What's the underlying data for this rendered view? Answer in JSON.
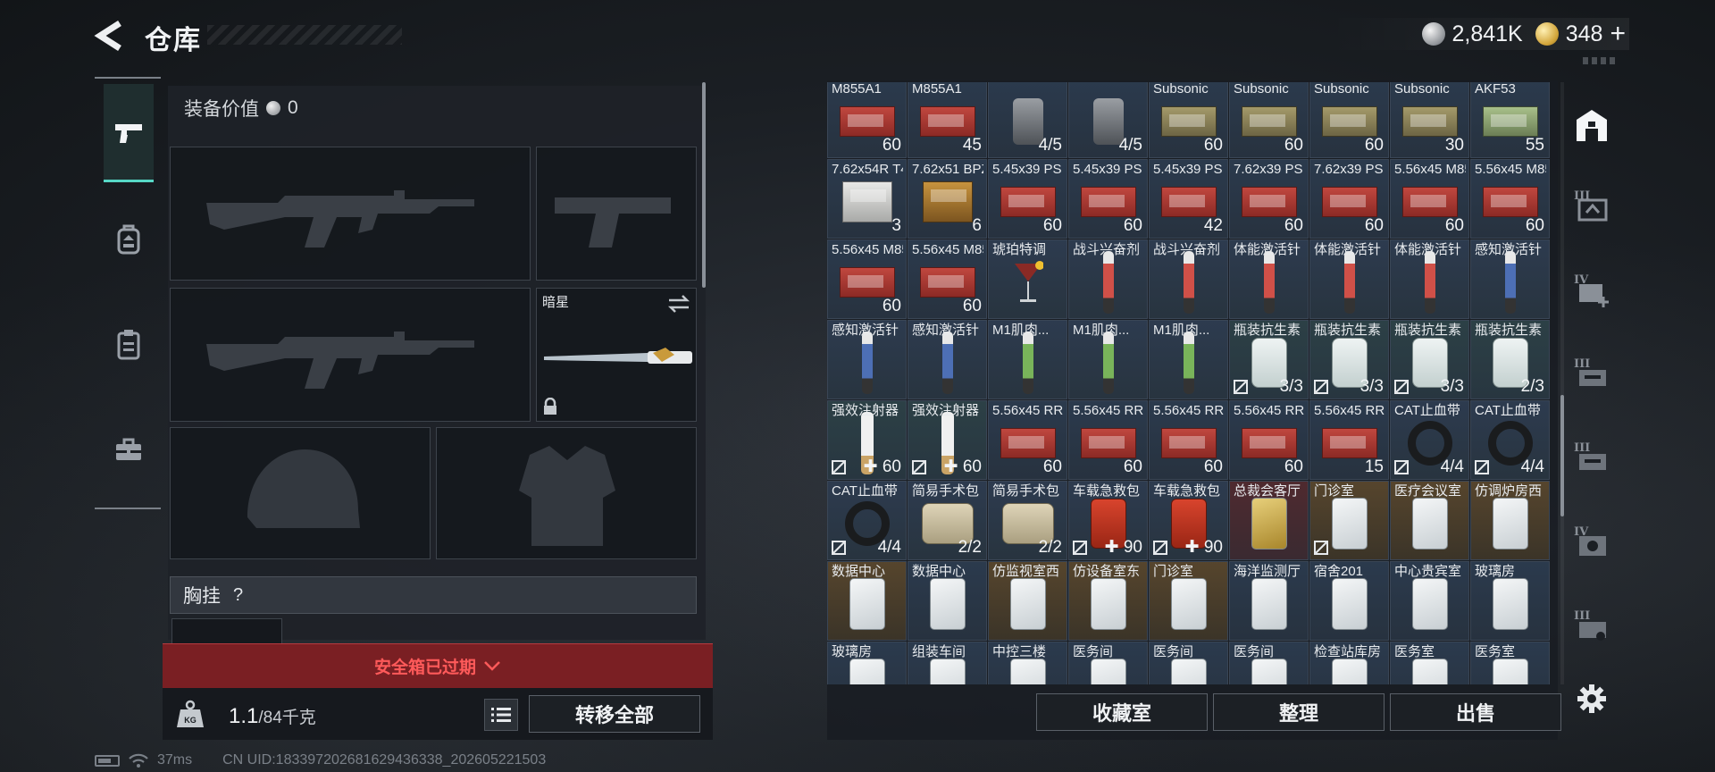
{
  "header": {
    "title": "仓库",
    "currencies": [
      {
        "icon": "silver-coin-icon",
        "value": "2,841K"
      },
      {
        "icon": "gold-coin-icon",
        "value": "348"
      }
    ],
    "add_label": "+"
  },
  "left_rail": {
    "items": [
      {
        "icon": "pistol-icon",
        "active": true
      },
      {
        "icon": "backpack-icon",
        "active": false
      },
      {
        "icon": "clipboard-icon",
        "active": false
      },
      {
        "icon": "toolbox-icon",
        "active": false
      }
    ]
  },
  "equipment": {
    "value_label": "装备价值",
    "value": "0",
    "melee_name": "暗星",
    "chest_rig_label": "胸挂",
    "chest_help": "?",
    "safebox_expired": "安全箱已过期",
    "weight_value": "1.1",
    "weight_capacity": "/84千克",
    "weight_icon_text": "KG",
    "transfer_all": "转移全部"
  },
  "status_bar": {
    "ping": "37ms",
    "uid": "CN UID:18339720268162943633​8_202605221503"
  },
  "inventory": {
    "items": [
      {
        "name": "M855A1",
        "qty": "60",
        "art": "box-red",
        "tone": "t-ammo"
      },
      {
        "name": "M855A1",
        "qty": "45",
        "art": "box-red",
        "tone": "t-ammo"
      },
      {
        "name": "",
        "qty": "4/5",
        "art": "grenade",
        "tone": "t-ammo"
      },
      {
        "name": "",
        "qty": "4/5",
        "art": "grenade",
        "tone": "t-ammo"
      },
      {
        "name": "Subsonic",
        "qty": "60",
        "art": "box-olive",
        "tone": "t-ammo"
      },
      {
        "name": "Subsonic",
        "qty": "60",
        "art": "box-olive",
        "tone": "t-ammo"
      },
      {
        "name": "Subsonic",
        "qty": "60",
        "art": "box-olive",
        "tone": "t-ammo"
      },
      {
        "name": "Subsonic",
        "qty": "30",
        "art": "box-olive",
        "tone": "t-ammo"
      },
      {
        "name": "AKF53",
        "qty": "55",
        "art": "box-green",
        "tone": "t-ammo"
      },
      {
        "name": "7.62x54R T46M",
        "qty": "3",
        "art": "box-white",
        "tone": "t-ammo"
      },
      {
        "name": "7.62x51 BPZ",
        "qty": "6",
        "art": "box-brown",
        "tone": "t-ammo"
      },
      {
        "name": "5.45x39 PS",
        "qty": "60",
        "art": "box-red",
        "tone": "t-ammo"
      },
      {
        "name": "5.45x39 PS",
        "qty": "60",
        "art": "box-red",
        "tone": "t-ammo"
      },
      {
        "name": "5.45x39 PS",
        "qty": "42",
        "art": "box-red",
        "tone": "t-ammo"
      },
      {
        "name": "7.62x39 PS",
        "qty": "60",
        "art": "box-red",
        "tone": "t-ammo"
      },
      {
        "name": "7.62x39 PS",
        "qty": "60",
        "art": "box-red",
        "tone": "t-ammo"
      },
      {
        "name": "5.56x45 M855",
        "qty": "60",
        "art": "box-red",
        "tone": "t-ammo"
      },
      {
        "name": "5.56x45 M855",
        "qty": "60",
        "art": "box-red",
        "tone": "t-ammo"
      },
      {
        "name": "5.56x45 M855",
        "qty": "60",
        "art": "box-red",
        "tone": "t-ammo"
      },
      {
        "name": "5.56x45 M855",
        "qty": "60",
        "art": "box-red",
        "tone": "t-ammo"
      },
      {
        "name": "琥珀特调",
        "qty": "",
        "art": "glass",
        "tone": "t-med"
      },
      {
        "name": "战斗兴奋剂",
        "qty": "",
        "art": "syringe red",
        "tone": "t-med"
      },
      {
        "name": "战斗兴奋剂",
        "qty": "",
        "art": "syringe red",
        "tone": "t-med"
      },
      {
        "name": "体能激活针",
        "qty": "",
        "art": "syringe red",
        "tone": "t-med"
      },
      {
        "name": "体能激活针",
        "qty": "",
        "art": "syringe red",
        "tone": "t-med"
      },
      {
        "name": "体能激活针",
        "qty": "",
        "art": "syringe red",
        "tone": "t-med"
      },
      {
        "name": "感知激活针",
        "qty": "",
        "art": "syringe blue",
        "tone": "t-med"
      },
      {
        "name": "感知激活针",
        "qty": "",
        "art": "syringe blue",
        "tone": "t-med"
      },
      {
        "name": "感知激活针",
        "qty": "",
        "art": "syringe blue",
        "tone": "t-med"
      },
      {
        "name": "M1肌肉...",
        "qty": "",
        "art": "syringe green",
        "tone": "t-med"
      },
      {
        "name": "M1肌肉...",
        "qty": "",
        "art": "syringe green",
        "tone": "t-med"
      },
      {
        "name": "M1肌肉...",
        "qty": "",
        "art": "syringe green",
        "tone": "t-med"
      },
      {
        "name": "瓶装抗生素",
        "qty": "3/3",
        "art": "pills",
        "tone": "t-green",
        "badge": "durability"
      },
      {
        "name": "瓶装抗生素",
        "qty": "3/3",
        "art": "pills",
        "tone": "t-green",
        "badge": "durability"
      },
      {
        "name": "瓶装抗生素",
        "qty": "3/3",
        "art": "pills",
        "tone": "t-green",
        "badge": "durability"
      },
      {
        "name": "瓶装抗生素",
        "qty": "2/3",
        "art": "pills",
        "tone": "t-green"
      },
      {
        "name": "强效注射器",
        "qty": "✚ 60",
        "art": "syringe white",
        "tone": "t-green",
        "badge": "durability"
      },
      {
        "name": "强效注射器",
        "qty": "✚ 60",
        "art": "syringe white",
        "tone": "t-green",
        "badge": "durability"
      },
      {
        "name": "5.56x45 RRLP",
        "qty": "60",
        "art": "box-red",
        "tone": "t-ammo"
      },
      {
        "name": "5.56x45 RRLP",
        "qty": "60",
        "art": "box-red",
        "tone": "t-ammo"
      },
      {
        "name": "5.56x45 RRLP",
        "qty": "60",
        "art": "box-red",
        "tone": "t-ammo"
      },
      {
        "name": "5.56x45 RRLP",
        "qty": "60",
        "art": "box-red",
        "tone": "t-ammo"
      },
      {
        "name": "5.56x45 RRLP",
        "qty": "15",
        "art": "box-red",
        "tone": "t-ammo"
      },
      {
        "name": "CAT止血带",
        "qty": "4/4",
        "art": "tourniquet",
        "tone": "t-med",
        "badge": "durability"
      },
      {
        "name": "CAT止血带",
        "qty": "4/4",
        "art": "tourniquet",
        "tone": "t-med",
        "badge": "durability"
      },
      {
        "name": "CAT止血带",
        "qty": "4/4",
        "art": "tourniquet",
        "tone": "t-med",
        "badge": "durability"
      },
      {
        "name": "简易手术包",
        "qty": "2/2",
        "art": "bag",
        "tone": "t-med"
      },
      {
        "name": "简易手术包",
        "qty": "2/2",
        "art": "bag",
        "tone": "t-med"
      },
      {
        "name": "车载急救包",
        "qty": "✚ 90",
        "art": "kit",
        "tone": "t-med",
        "badge": "durability"
      },
      {
        "name": "车载急救包",
        "qty": "✚ 90",
        "art": "kit",
        "tone": "t-med",
        "badge": "durability"
      },
      {
        "name": "总裁会客厅",
        "qty": "",
        "art": "card gold",
        "tone": "t-red"
      },
      {
        "name": "门诊室",
        "qty": "",
        "art": "card",
        "tone": "t-gold",
        "badge": "durability"
      },
      {
        "name": "医疗会议室",
        "qty": "",
        "art": "card",
        "tone": "t-gold"
      },
      {
        "name": "仿调炉房西",
        "qty": "",
        "art": "card",
        "tone": "t-gold"
      },
      {
        "name": "数据中心",
        "qty": "",
        "art": "card",
        "tone": "t-gold"
      },
      {
        "name": "数据中心",
        "qty": "",
        "art": "card",
        "tone": "t-ammo"
      },
      {
        "name": "仿监视室西",
        "qty": "",
        "art": "card",
        "tone": "t-gold"
      },
      {
        "name": "仿设备室东",
        "qty": "",
        "art": "card",
        "tone": "t-gold"
      },
      {
        "name": "门诊室",
        "qty": "",
        "art": "card",
        "tone": "t-gold"
      },
      {
        "name": "海洋监测厅",
        "qty": "",
        "art": "card",
        "tone": "t-ammo"
      },
      {
        "name": "宿舍201",
        "qty": "",
        "art": "card",
        "tone": "t-ammo"
      },
      {
        "name": "中心贵宾室",
        "qty": "",
        "art": "card",
        "tone": "t-ammo"
      },
      {
        "name": "玻璃房",
        "qty": "",
        "art": "card",
        "tone": "t-ammo"
      },
      {
        "name": "玻璃房",
        "qty": "",
        "art": "card",
        "tone": "t-ammo"
      },
      {
        "name": "组装车间",
        "qty": "",
        "art": "card",
        "tone": "t-ammo"
      },
      {
        "name": "中控三楼",
        "qty": "",
        "art": "card",
        "tone": "t-ammo"
      },
      {
        "name": "医务间",
        "qty": "",
        "art": "card",
        "tone": "t-ammo"
      },
      {
        "name": "医务间",
        "qty": "",
        "art": "card",
        "tone": "t-ammo"
      },
      {
        "name": "医务间",
        "qty": "",
        "art": "card",
        "tone": "t-ammo"
      },
      {
        "name": "检查站库房",
        "qty": "",
        "art": "card",
        "tone": "t-ammo"
      },
      {
        "name": "医务室",
        "qty": "",
        "art": "card",
        "tone": "t-ammo"
      },
      {
        "name": "医务室",
        "qty": "",
        "art": "card",
        "tone": "t-ammo"
      }
    ],
    "actions": {
      "collection": "收藏室",
      "sort": "整理",
      "sell": "出售"
    }
  },
  "right_rail": {
    "items": [
      {
        "icon": "home-base-icon",
        "roman": ""
      },
      {
        "icon": "case-level-icon",
        "roman": "III"
      },
      {
        "icon": "case-add-icon",
        "roman": "IV"
      },
      {
        "icon": "case-level-icon",
        "roman": "III"
      },
      {
        "icon": "case-level-icon",
        "roman": "III"
      },
      {
        "icon": "case-level-icon",
        "roman": "IV"
      },
      {
        "icon": "case-level-icon",
        "roman": "III"
      }
    ],
    "settings_icon": "gear-icon"
  },
  "colors": {
    "accent_teal": "#56d7c5",
    "danger_red": "#ff5a5a",
    "panel_dark": "#1e2228"
  }
}
